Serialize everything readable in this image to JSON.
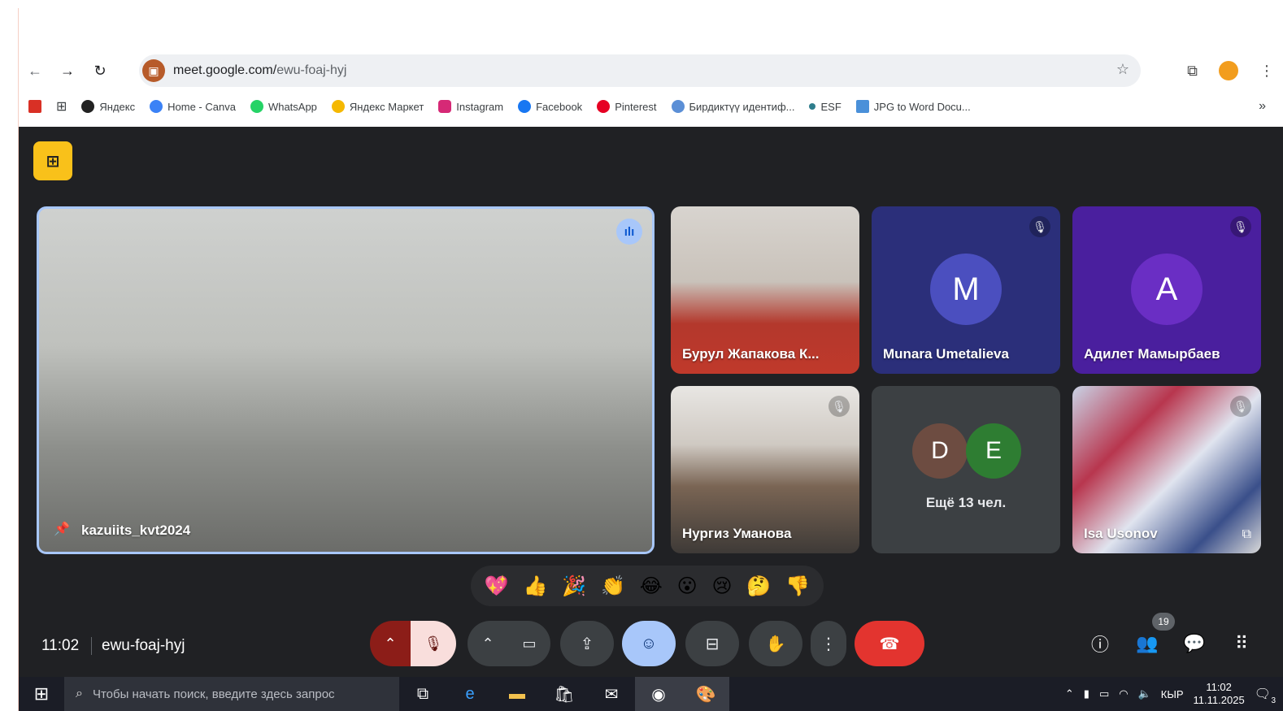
{
  "browser": {
    "url_host": "meet.google.com/",
    "url_path": "ewu-foaj-hyj",
    "bookmarks": [
      {
        "label": "Яндекс",
        "color": "#222222"
      },
      {
        "label": "Home - Canva",
        "color": "#3b82f6"
      },
      {
        "label": "WhatsApp",
        "color": "#25d366"
      },
      {
        "label": "Яндекс Маркет",
        "color": "#f5b800"
      },
      {
        "label": "Instagram",
        "color": "#d62976"
      },
      {
        "label": "Facebook",
        "color": "#1877f2"
      },
      {
        "label": "Pinterest",
        "color": "#e60023"
      },
      {
        "label": "Бирдиктүү идентиф...",
        "color": "#5b8fd6"
      },
      {
        "label": "ESF",
        "color": "#2e7d8c"
      },
      {
        "label": "JPG to Word Docu...",
        "color": "#4a90d9"
      }
    ],
    "more": "»"
  },
  "meet": {
    "main": {
      "name": "kazuiits_kvt2024"
    },
    "tiles": [
      {
        "name": "Бурул Жапакова К...",
        "type": "video",
        "bg": "#c0392b"
      },
      {
        "name": "Munara Umetalieva",
        "type": "avatar",
        "letter": "M",
        "bg": "#2b2f7a",
        "avatar_bg": "#4b4fbf"
      },
      {
        "name": "Адилет Мамырбаев",
        "type": "avatar",
        "letter": "A",
        "bg": "#4a1f9e",
        "avatar_bg": "#6a2ec4"
      },
      {
        "name": "Нургиз Уманова",
        "type": "video",
        "bg": "#6b5a4c"
      },
      {
        "name": "",
        "type": "others",
        "letters": [
          "D",
          "E"
        ],
        "text": "Ещё 13 чел."
      },
      {
        "name": "Isa Usonov",
        "type": "video",
        "bg": "#8a2a3c"
      }
    ],
    "reactions": [
      "💖",
      "👍",
      "🎉",
      "👏",
      "😂",
      "😮",
      "😢",
      "🤔",
      "👎"
    ],
    "time": "11:02",
    "code": "ewu-foaj-hyj",
    "participants_count": "19"
  },
  "taskbar": {
    "search_placeholder": "Чтобы начать поиск, введите здесь запрос",
    "lang": "КЫР",
    "time": "11:02",
    "date": "11.11.2025",
    "notif": "3"
  }
}
